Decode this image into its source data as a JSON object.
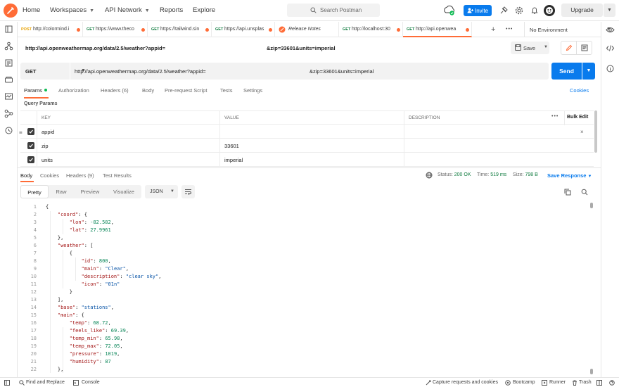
{
  "nav": {
    "home": "Home",
    "workspaces": "Workspaces",
    "api_network": "API Network",
    "reports": "Reports",
    "explore": "Explore",
    "search_placeholder": "Search Postman",
    "invite": "Invite",
    "upgrade": "Upgrade"
  },
  "tabs": [
    {
      "method": "POST",
      "url": "http://colormind.i",
      "dot": true
    },
    {
      "method": "GET",
      "url": "https://www.theco",
      "dot": true
    },
    {
      "method": "GET",
      "url": "https://tailwind.sin",
      "dot": true
    },
    {
      "method": "GET",
      "url": "https://api.unsplas",
      "dot": true
    },
    {
      "method": "",
      "url": "Release Notes",
      "dot": false
    },
    {
      "method": "GET",
      "url": "http://localhost:30",
      "dot": true
    },
    {
      "method": "GET",
      "url": "http://api.openwea",
      "dot": true,
      "active": true
    }
  ],
  "environment": "No Environment",
  "request": {
    "name_part1": "http://api.openweathermap.org/data/2.5/weather?appid=",
    "name_part2": "&zip=33601&units=imperial",
    "save": "Save",
    "method": "GET",
    "url_part1": "http://api.openweathermap.org/data/2.5/weather?appid=",
    "url_part2": "&zip=33601&units=imperial",
    "send": "Send"
  },
  "request_tabs": {
    "params": "Params",
    "authorization": "Authorization",
    "headers": "Headers (6)",
    "body": "Body",
    "prerequest": "Pre-request Script",
    "tests": "Tests",
    "settings": "Settings",
    "cookies": "Cookies"
  },
  "query_params": {
    "label": "Query Params",
    "headers": {
      "key": "KEY",
      "value": "VALUE",
      "description": "DESCRIPTION",
      "bulk_edit": "Bulk Edit"
    },
    "rows": [
      {
        "key": "appid",
        "value": "",
        "description": ""
      },
      {
        "key": "zip",
        "value": "33601",
        "description": ""
      },
      {
        "key": "units",
        "value": "imperial",
        "description": ""
      }
    ]
  },
  "response_tabs": {
    "body": "Body",
    "cookies": "Cookies",
    "headers": "Headers (9)",
    "test_results": "Test Results",
    "status_label": "Status:",
    "status_value": "200 OK",
    "time_label": "Time:",
    "time_value": "519 ms",
    "size_label": "Size:",
    "size_value": "798 B",
    "save_response": "Save Response"
  },
  "view_modes": {
    "pretty": "Pretty",
    "raw": "Raw",
    "preview": "Preview",
    "visualize": "Visualize",
    "format": "JSON"
  },
  "code_lines": [
    {
      "n": "1",
      "t": "{"
    },
    {
      "n": "2",
      "t": "    \"coord\": {"
    },
    {
      "n": "3",
      "t": "        \"lon\": -82.582,"
    },
    {
      "n": "4",
      "t": "        \"lat\": 27.9961"
    },
    {
      "n": "5",
      "t": "    },"
    },
    {
      "n": "6",
      "t": "    \"weather\": ["
    },
    {
      "n": "7",
      "t": "        {"
    },
    {
      "n": "8",
      "t": "            \"id\": 800,"
    },
    {
      "n": "9",
      "t": "            \"main\": \"Clear\","
    },
    {
      "n": "10",
      "t": "            \"description\": \"clear sky\","
    },
    {
      "n": "11",
      "t": "            \"icon\": \"01n\""
    },
    {
      "n": "12",
      "t": "        }"
    },
    {
      "n": "13",
      "t": "    ],"
    },
    {
      "n": "14",
      "t": "    \"base\": \"stations\","
    },
    {
      "n": "15",
      "t": "    \"main\": {"
    },
    {
      "n": "16",
      "t": "        \"temp\": 68.72,"
    },
    {
      "n": "17",
      "t": "        \"feels_like\": 69.39,"
    },
    {
      "n": "18",
      "t": "        \"temp_min\": 65.98,"
    },
    {
      "n": "19",
      "t": "        \"temp_max\": 72.05,"
    },
    {
      "n": "20",
      "t": "        \"pressure\": 1019,"
    },
    {
      "n": "21",
      "t": "        \"humidity\": 87"
    },
    {
      "n": "22",
      "t": "    },"
    }
  ],
  "footer": {
    "find_replace": "Find and Replace",
    "console": "Console",
    "capture": "Capture requests and cookies",
    "bootcamp": "Bootcamp",
    "runner": "Runner",
    "trash": "Trash"
  },
  "colors": {
    "accent": "#ff6c37",
    "primary": "#097bed",
    "success": "#0f7b3f"
  }
}
